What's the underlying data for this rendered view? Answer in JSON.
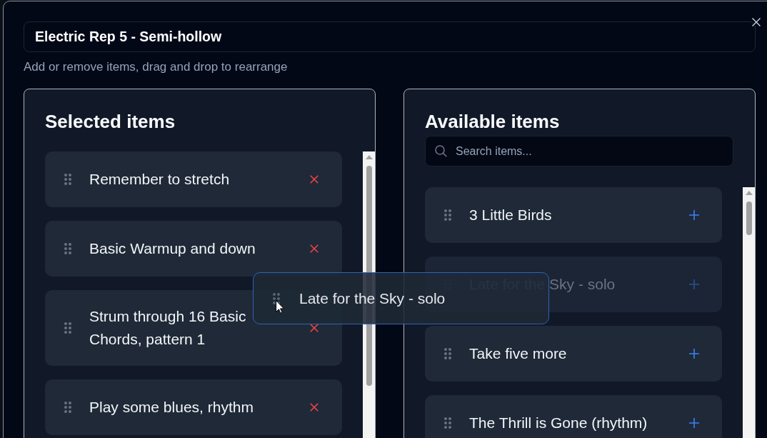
{
  "dialog": {
    "title_value": "Electric Rep 5 - Semi-hollow",
    "subtitle": "Add or remove items, drag and drop to rearrange"
  },
  "selected_panel": {
    "title": "Selected items",
    "items": [
      {
        "label": "Remember to stretch"
      },
      {
        "label": "Basic Warmup and down"
      },
      {
        "label": "Strum through 16 Basic Chords, pattern 1"
      },
      {
        "label": "Play some blues, rhythm"
      }
    ]
  },
  "available_panel": {
    "title": "Available items",
    "search": {
      "placeholder": "Search items..."
    },
    "items": [
      {
        "label": "3 Little Birds",
        "dragging": false
      },
      {
        "label": "Late for the Sky - solo",
        "dragging": true
      },
      {
        "label": "Take five more",
        "dragging": false
      },
      {
        "label": "The Thrill is Gone (rhythm)",
        "dragging": false
      }
    ]
  },
  "drag_preview": {
    "label": "Late for the Sky - solo"
  }
}
